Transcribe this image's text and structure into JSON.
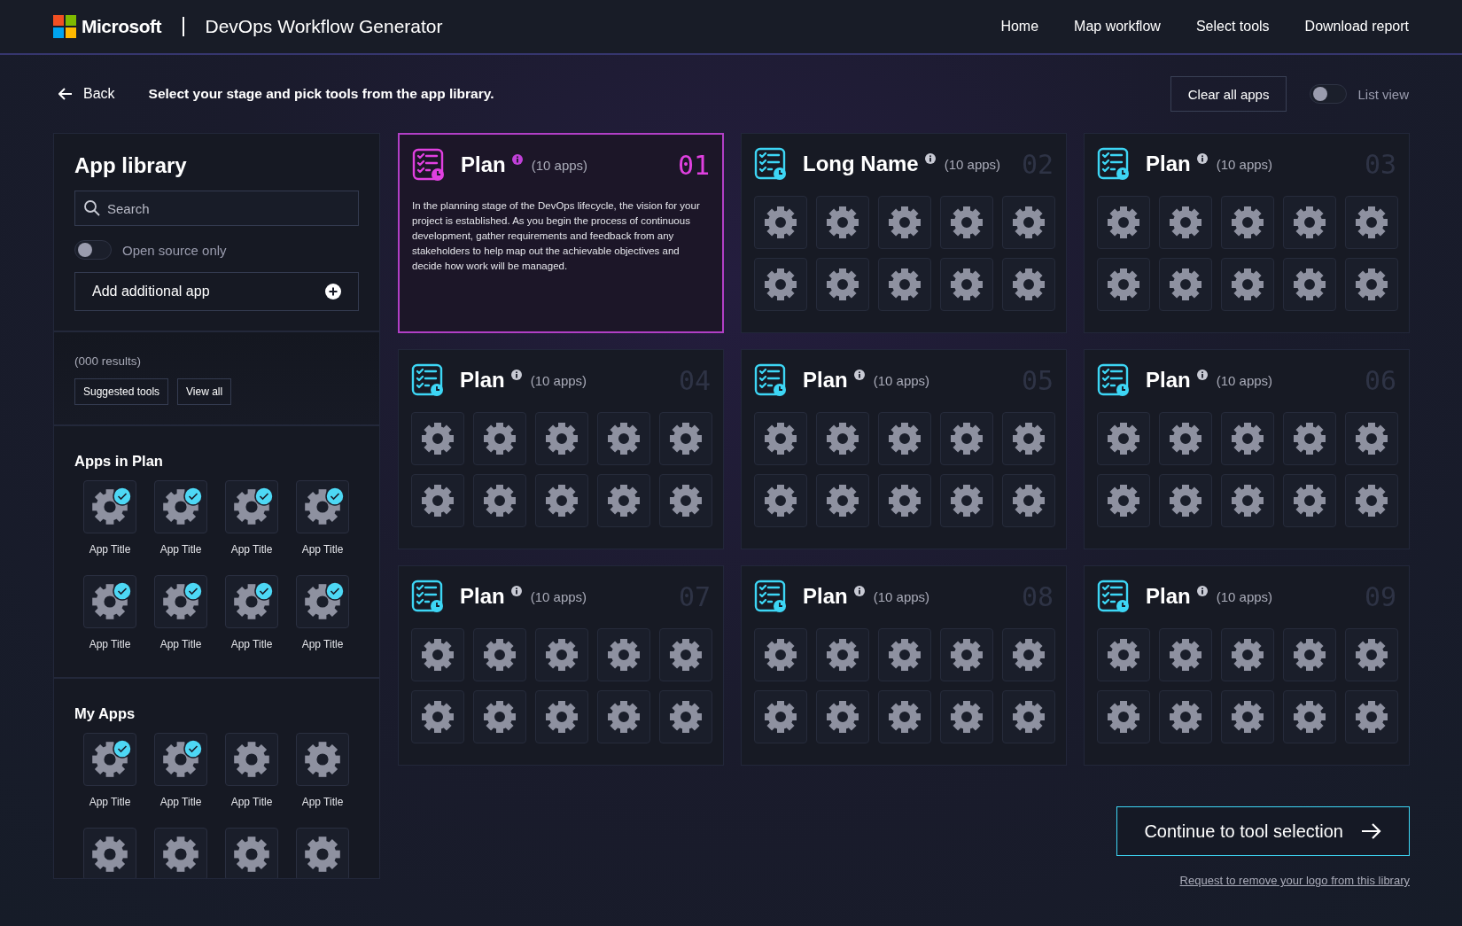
{
  "header": {
    "brand": "Microsoft",
    "title": "DevOps Workflow Generator",
    "nav": [
      "Home",
      "Map workflow",
      "Select tools",
      "Download report"
    ]
  },
  "toolbar": {
    "back": "Back",
    "instruction": "Select your stage and pick tools from the app library.",
    "clear_button": "Clear all apps",
    "list_view": {
      "label": "List view",
      "on": false
    }
  },
  "sidebar": {
    "title": "App library",
    "search": {
      "placeholder": "Search"
    },
    "open_source": {
      "label": "Open source only",
      "on": false
    },
    "add_button": "Add additional app",
    "results": "(000 results)",
    "filters": [
      "Suggested tools",
      "View all"
    ],
    "sections": [
      {
        "title": "Apps in Plan",
        "apps": [
          {
            "label": "App Title",
            "checked": true
          },
          {
            "label": "App Title",
            "checked": true
          },
          {
            "label": "App Title",
            "checked": true
          },
          {
            "label": "App Title",
            "checked": true
          },
          {
            "label": "App Title",
            "checked": true
          },
          {
            "label": "App Title",
            "checked": true
          },
          {
            "label": "App Title",
            "checked": true
          },
          {
            "label": "App Title",
            "checked": true
          }
        ]
      },
      {
        "title": "My Apps",
        "apps": [
          {
            "label": "App Title",
            "checked": true
          },
          {
            "label": "App Title",
            "checked": true
          },
          {
            "label": "App Title",
            "checked": false
          },
          {
            "label": "App Title",
            "checked": false
          },
          {
            "checked": false
          },
          {
            "checked": false
          },
          {
            "checked": false
          },
          {
            "checked": false
          }
        ]
      }
    ]
  },
  "stages": [
    {
      "name": "Plan",
      "count": "(10 apps)",
      "number": "01",
      "selected": true,
      "description": "In the planning stage of the DevOps lifecycle, the vision for your project is established. As you begin the process of continuous development, gather requirements and feedback from any stakeholders to help map out the achievable objectives and decide how work will be managed."
    },
    {
      "name": "Long Name",
      "count": "(10 apps)",
      "number": "02",
      "selected": false
    },
    {
      "name": "Plan",
      "count": "(10 apps)",
      "number": "03",
      "selected": false
    },
    {
      "name": "Plan",
      "count": "(10 apps)",
      "number": "04",
      "selected": false
    },
    {
      "name": "Plan",
      "count": "(10 apps)",
      "number": "05",
      "selected": false
    },
    {
      "name": "Plan",
      "count": "(10 apps)",
      "number": "06",
      "selected": false
    },
    {
      "name": "Plan",
      "count": "(10 apps)",
      "number": "07",
      "selected": false
    },
    {
      "name": "Plan",
      "count": "(10 apps)",
      "number": "08",
      "selected": false
    },
    {
      "name": "Plan",
      "count": "(10 apps)",
      "number": "09",
      "selected": false
    }
  ],
  "continue_button": "Continue to tool selection",
  "remove_logo_link": "Request to remove your logo from this library"
}
